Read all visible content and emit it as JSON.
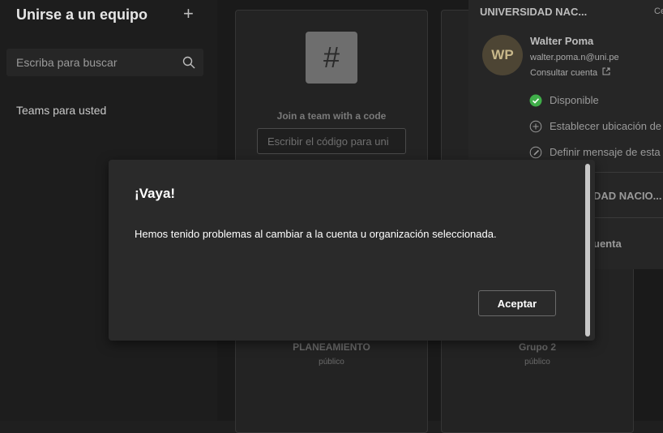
{
  "sidebar": {
    "title": "Unirse a un equipo",
    "search_placeholder": "Escriba para buscar",
    "nav_item": "Teams para usted"
  },
  "main": {
    "join_label": "Join a team with a code",
    "code_placeholder": "Escribir el código para uni",
    "teams": [
      {
        "name": "PLANEAMIENTO",
        "visibility": "público"
      },
      {
        "name": "Grupo 2",
        "visibility": "público"
      }
    ]
  },
  "account": {
    "org_name": "UNIVERSIDAD NAC...",
    "org_right_text": "Ce",
    "avatar_initials": "WP",
    "user_name": "Walter Poma",
    "email": "walter.poma.n@uni.pe",
    "view_account": "Consultar cuenta",
    "status": "Disponible",
    "set_location": "Establecer ubicación de",
    "set_message": "Definir mensaje de esta",
    "org_name_2": "DAD NACIO...",
    "account_item": "uenta"
  },
  "dialog": {
    "title": "¡Vaya!",
    "message": "Hemos tenido problemas al cambiar a la cuenta u organización seleccionada.",
    "accept_label": "Aceptar"
  },
  "colors": {
    "status_green": "#3fae49",
    "background": "#1f1f1f",
    "dialog_bg": "#2a2a2a"
  }
}
